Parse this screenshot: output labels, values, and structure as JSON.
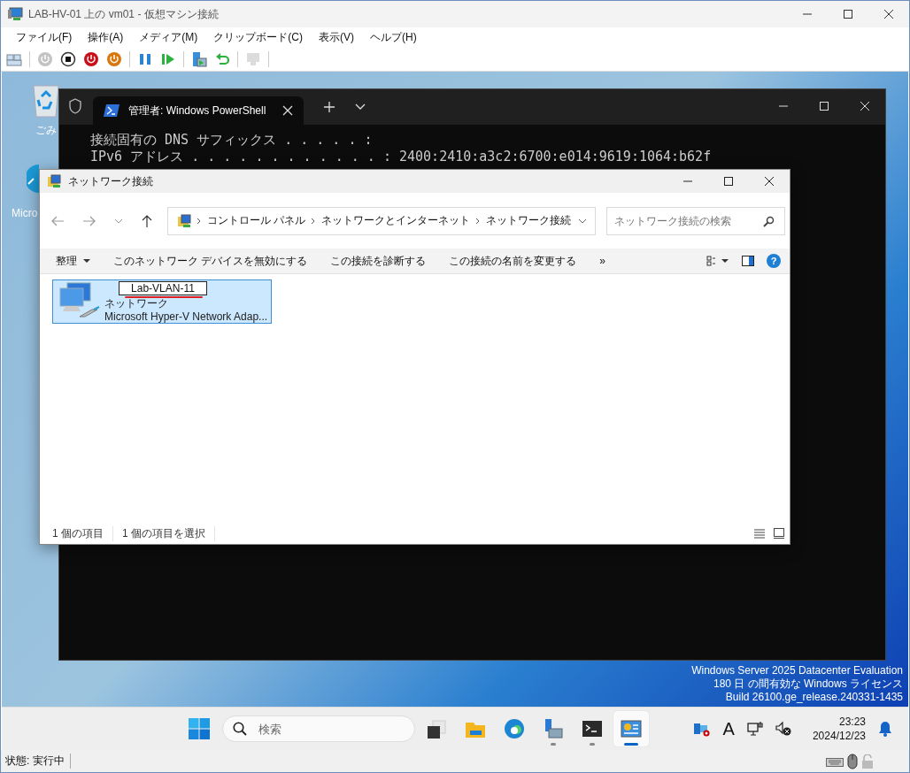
{
  "window": {
    "title": "LAB-HV-01 上の vm01  - 仮想マシン接続"
  },
  "menu": [
    "ファイル(F)",
    "操作(A)",
    "メディア(M)",
    "クリップボード(C)",
    "表示(V)",
    "ヘルプ(H)"
  ],
  "toolbar": [
    {
      "kind": "ctrl-alt-del",
      "disabled": false
    },
    {
      "kind": "start",
      "disabled": true
    },
    {
      "kind": "turn-off",
      "disabled": false
    },
    {
      "kind": "shut-down",
      "disabled": false
    },
    {
      "kind": "save",
      "disabled": false
    },
    {
      "kind": "pause",
      "disabled": false
    },
    {
      "kind": "reset",
      "disabled": false
    },
    {
      "kind": "checkpoint",
      "disabled": false
    },
    {
      "kind": "revert",
      "disabled": false
    },
    {
      "kind": "enhanced",
      "disabled": true
    }
  ],
  "desktop": {
    "icons": [
      {
        "kind": "recycle-bin",
        "label": "ごみ"
      },
      {
        "kind": "edge",
        "label": "Micro"
      }
    ],
    "notice": [
      "Windows Server 2025 Datacenter Evaluation",
      "180 日 の間有効な Windows ライセンス",
      "Build 26100.ge_release.240331-1435"
    ]
  },
  "powershell": {
    "tab_title": "管理者: Windows PowerShell",
    "lines": [
      "接続固有の DNS サフィックス . . . . . :",
      "IPv6 アドレス . . . . . . . . . . . . : 2400:2410:a3c2:6700:e014:9619:1064:b62f"
    ]
  },
  "explorer": {
    "title": "ネットワーク接続",
    "breadcrumb": [
      "コントロール パネル",
      "ネットワークとインターネット",
      "ネットワーク接続"
    ],
    "search": {
      "placeholder": "ネットワーク接続の検索"
    },
    "commands": [
      {
        "label": "整理",
        "dropdown": true
      },
      {
        "label": "このネットワーク デバイスを無効にする",
        "dropdown": false
      },
      {
        "label": "この接続を診断する",
        "dropdown": false
      },
      {
        "label": "この接続の名前を変更する",
        "dropdown": false
      },
      {
        "label": "»",
        "dropdown": false
      }
    ],
    "items": [
      {
        "name": "Lab-VLAN-11",
        "renaming": true,
        "status": "ネットワーク",
        "device": "Microsoft Hyper-V Network Adap...",
        "selected": true
      }
    ],
    "help": "?",
    "status_bar": [
      "1 個の項目",
      "1 個の項目を選択"
    ]
  },
  "taskbar": {
    "search": {
      "placeholder": "検索"
    },
    "apps": [
      {
        "kind": "task-view",
        "running": false,
        "selected": false
      },
      {
        "kind": "folder",
        "running": false,
        "selected": false
      },
      {
        "kind": "edge",
        "running": false,
        "selected": false
      },
      {
        "kind": "server-manager",
        "running": true,
        "selected": false
      },
      {
        "kind": "terminal",
        "running": true,
        "selected": false
      },
      {
        "kind": "control-panel",
        "running": true,
        "selected": true
      }
    ],
    "ime": "A",
    "time": "23:23",
    "date": "2024/12/23"
  },
  "status_bar": {
    "text": "状態: 実行中"
  }
}
